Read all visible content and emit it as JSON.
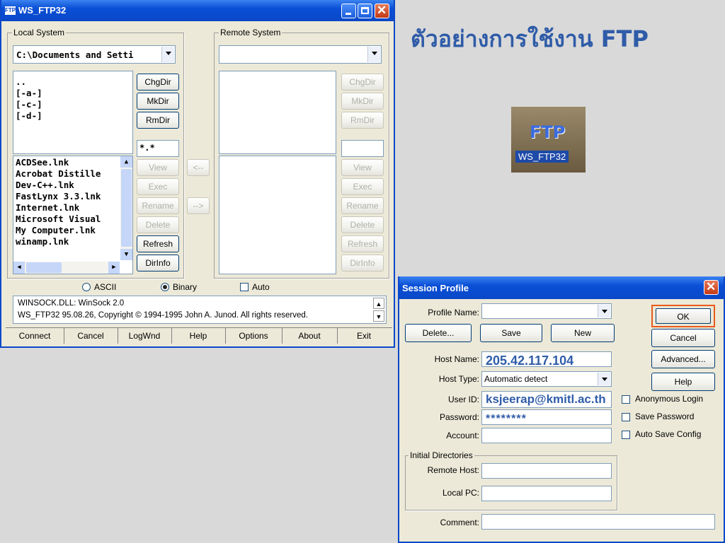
{
  "slide_title": "ตัวอย่างการใช้งาน FTP",
  "desktop_icon_label": "WS_FTP32",
  "desktop_icon_glyph": "FTP",
  "ftp_window": {
    "title": "WS_FTP32",
    "local_label": "Local System",
    "remote_label": "Remote System",
    "local_path": "C:\\Documents and Setti",
    "local_dirs": [
      "..",
      "[-a-]",
      "[-c-]",
      "[-d-]"
    ],
    "local_files": [
      "ACDSee.lnk",
      "Acrobat Distille",
      "Dev-C++.lnk",
      "FastLynx 3.3.lnk",
      "Internet.lnk",
      "Microsoft Visual",
      "My Computer.lnk",
      "winamp.lnk"
    ],
    "local_filter": "*.*",
    "side_buttons": [
      "ChgDir",
      "MkDir",
      "RmDir",
      "View",
      "Exec",
      "Rename",
      "Delete",
      "Refresh",
      "DirInfo"
    ],
    "left_arrow": "<--",
    "right_arrow": "-->",
    "mode_ascii": "ASCII",
    "mode_binary": "Binary",
    "mode_auto": "Auto",
    "status_line1": "WINSOCK.DLL: WinSock 2.0",
    "status_line2": "WS_FTP32 95.08.26, Copyright © 1994-1995 John A. Junod. All rights reserved.",
    "bottom_buttons": [
      "Connect",
      "Cancel",
      "LogWnd",
      "Help",
      "Options",
      "About",
      "Exit"
    ]
  },
  "session": {
    "title": "Session Profile",
    "profile_name_label": "Profile Name:",
    "delete_label": "Delete...",
    "save_label": "Save",
    "new_label": "New",
    "ok_label": "OK",
    "cancel_label": "Cancel",
    "advanced_label": "Advanced...",
    "help_label": "Help",
    "host_name_label": "Host Name:",
    "host_name_value": "205.42.117.104",
    "host_type_label": "Host Type:",
    "host_type_value": "Automatic detect",
    "user_id_label": "User ID:",
    "user_id_value": "ksjeerap@kmitl.ac.th",
    "password_label": "Password:",
    "password_value": "********",
    "account_label": "Account:",
    "anonymous_label": "Anonymous Login",
    "save_password_label": "Save Password",
    "auto_save_label": "Auto Save Config",
    "initial_dirs_label": "Initial Directories",
    "remote_host_label": "Remote Host:",
    "local_pc_label": "Local PC:",
    "comment_label": "Comment:"
  },
  "colors": {
    "title_blue": "#2f5ca8",
    "ok_highlight": "#e85a1c"
  }
}
